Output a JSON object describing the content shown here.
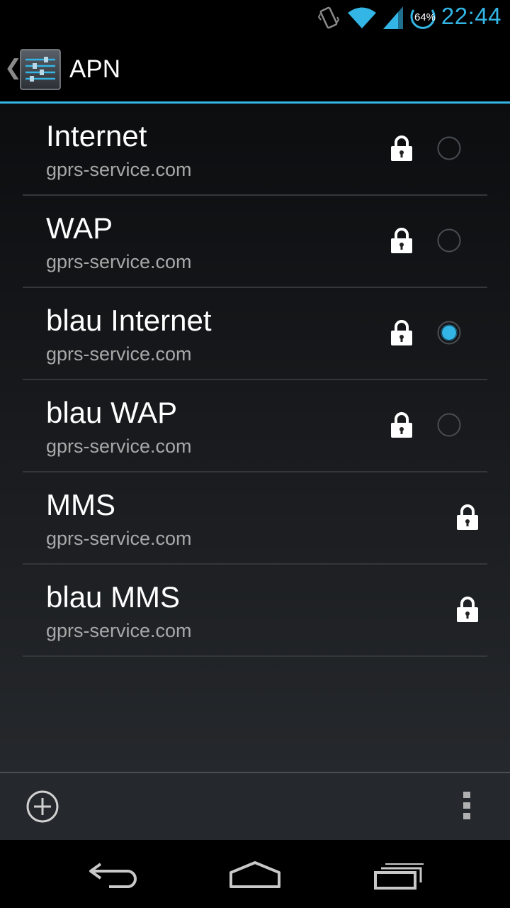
{
  "status_bar": {
    "time": "22:44",
    "battery_percent": "64%",
    "icons": [
      "vibrate-icon",
      "wifi-icon",
      "signal-icon",
      "battery-icon"
    ]
  },
  "action_bar": {
    "title": "APN",
    "icon": "settings-sliders-icon"
  },
  "apn_list": [
    {
      "name": "Internet",
      "server": "gprs-service.com",
      "locked": true,
      "has_radio": true,
      "selected": false
    },
    {
      "name": "WAP",
      "server": "gprs-service.com",
      "locked": true,
      "has_radio": true,
      "selected": false
    },
    {
      "name": "blau Internet",
      "server": "gprs-service.com",
      "locked": true,
      "has_radio": true,
      "selected": true
    },
    {
      "name": "blau WAP",
      "server": "gprs-service.com",
      "locked": true,
      "has_radio": true,
      "selected": false
    },
    {
      "name": "MMS",
      "server": "gprs-service.com",
      "locked": true,
      "has_radio": false,
      "selected": false
    },
    {
      "name": "blau MMS",
      "server": "gprs-service.com",
      "locked": true,
      "has_radio": false,
      "selected": false
    }
  ],
  "bottom_bar": {
    "icons": [
      "add-icon",
      "overflow-menu-icon"
    ]
  },
  "nav_bar": {
    "icons": [
      "back-icon",
      "home-icon",
      "recent-apps-icon"
    ]
  },
  "colors": {
    "accent": "#33b5e5",
    "background": "#000000",
    "secondary_text": "#a8a8a8"
  }
}
